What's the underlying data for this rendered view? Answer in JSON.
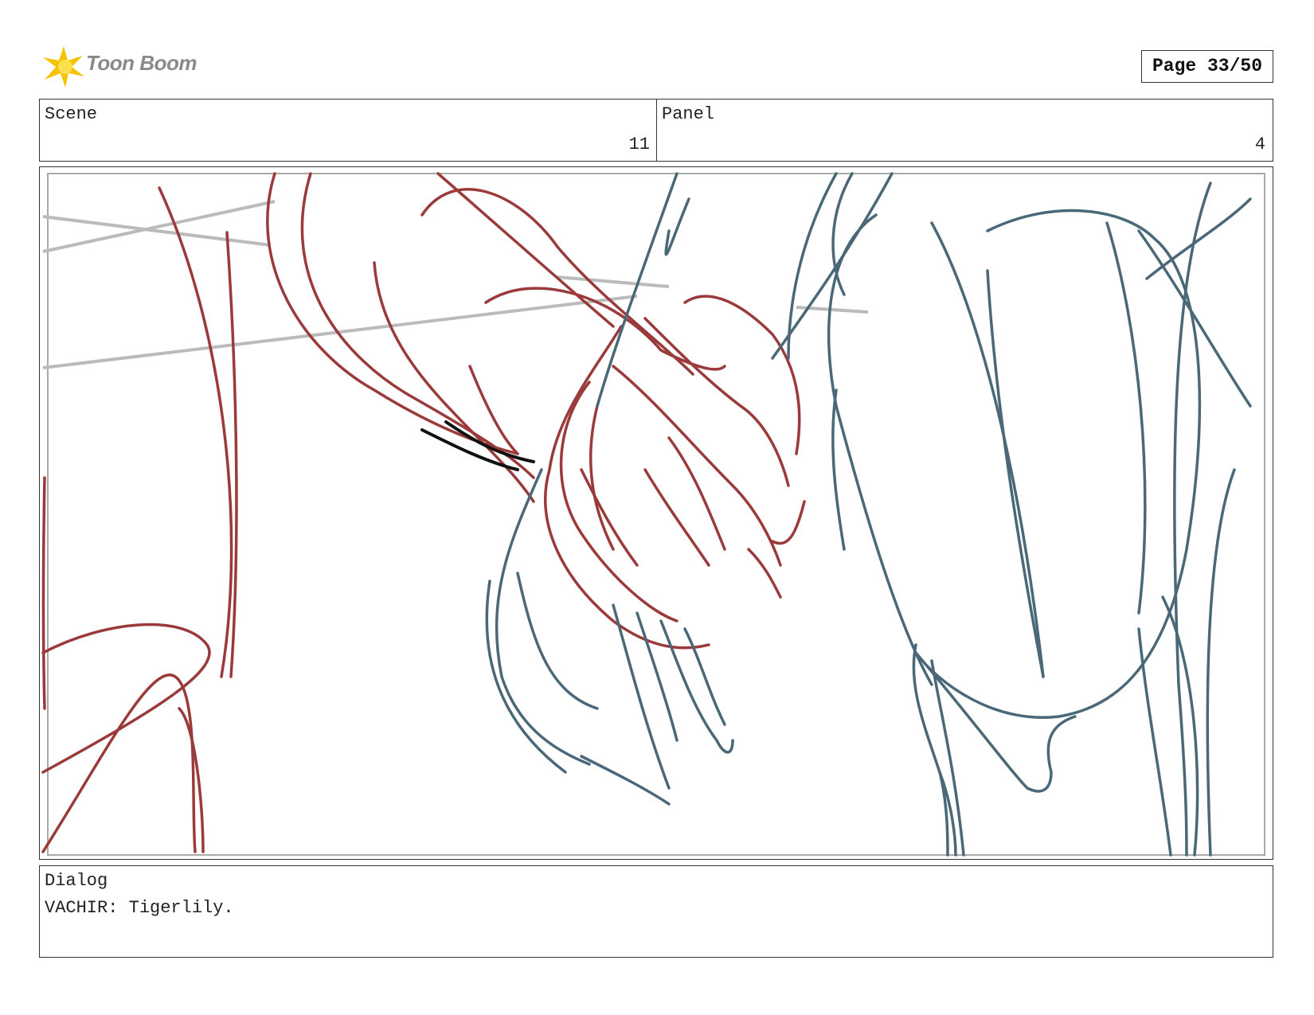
{
  "header": {
    "logo_text": "Toon Boom",
    "page_label": "Page 33/50"
  },
  "scene": {
    "label": "Scene",
    "value": "11"
  },
  "panel": {
    "label": "Panel",
    "value": "4"
  },
  "dialog": {
    "label": "Dialog",
    "text": "VACHIR: Tigerlily."
  },
  "sketch": {
    "colors": {
      "red": "#9a3a3a",
      "blue": "#4a6878",
      "gray": "#bbbbbb",
      "black": "#111111"
    }
  }
}
